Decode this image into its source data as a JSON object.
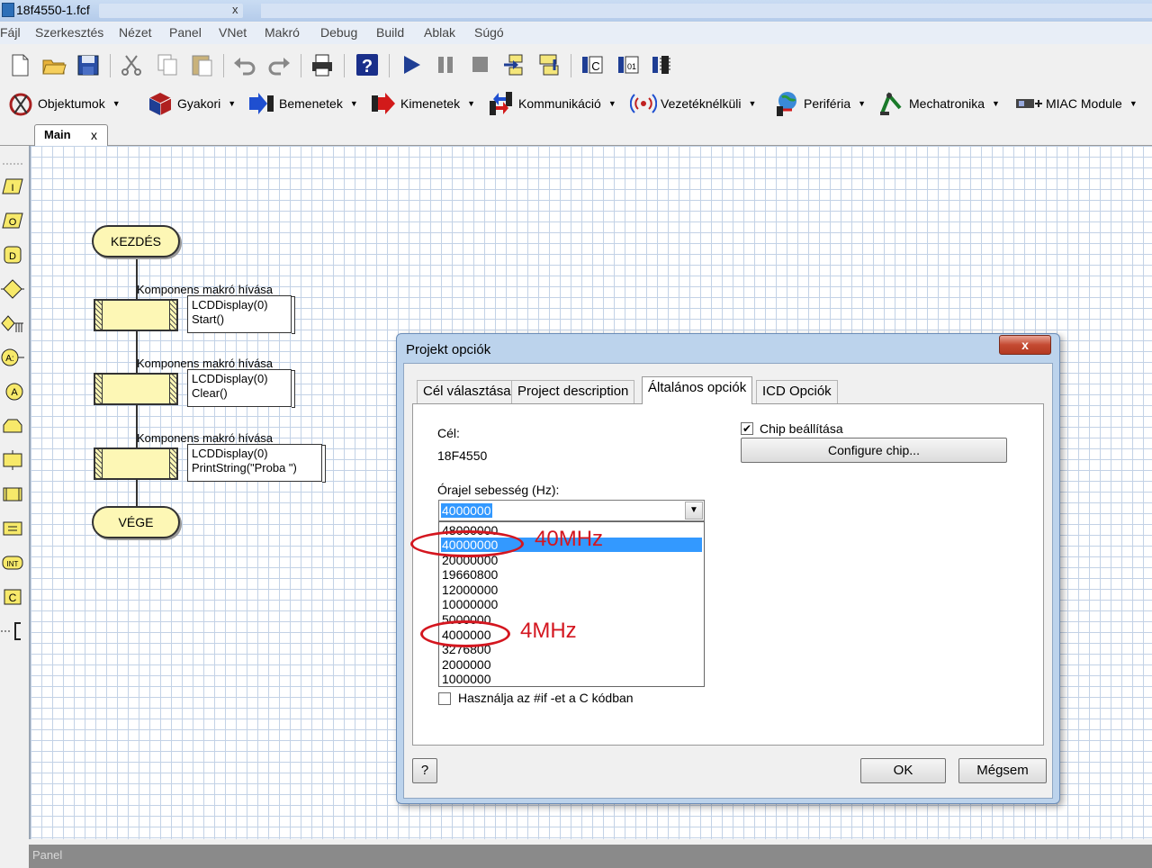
{
  "window": {
    "title": "18f4550-1.fcf",
    "close_glyph": "x"
  },
  "menu": [
    "Fájl",
    "Szerkesztés",
    "Nézet",
    "Panel",
    "VNet",
    "Makró",
    "Debug",
    "Build",
    "Ablak",
    "Súgó"
  ],
  "toolbar_components": [
    {
      "label": "Objektumok"
    },
    {
      "label": "Gyakori"
    },
    {
      "label": "Bemenetek"
    },
    {
      "label": "Kimenetek"
    },
    {
      "label": "Kommunikáció"
    },
    {
      "label": "Vezetéknélküli"
    },
    {
      "label": "Periféria"
    },
    {
      "label": "Mechatronika"
    },
    {
      "label": "MIAC Module"
    }
  ],
  "tab": {
    "label": "Main",
    "close": "x"
  },
  "flowchart": {
    "start": "KEZDÉS",
    "end": "VÉGE",
    "macros": [
      {
        "heading": "Komponens makró hívása",
        "line1": "LCDDisplay(0)",
        "line2": "Start()"
      },
      {
        "heading": "Komponens makró hívása",
        "line1": "LCDDisplay(0)",
        "line2": "Clear()"
      },
      {
        "heading": "Komponens makró hívása",
        "line1": "LCDDisplay(0)",
        "line2": "PrintString(\"Proba \")"
      }
    ]
  },
  "dialog": {
    "title": "Projekt opciók",
    "close": "x",
    "tabs": [
      "Cél választása",
      "Project description",
      "Általános opciók",
      "ICD Opciók"
    ],
    "active_tab": 2,
    "target_label": "Cél:",
    "target_value": "18F4550",
    "clock_label": "Órajel sebesség (Hz):",
    "clock_value": "4000000",
    "clock_options": [
      "48000000",
      "40000000",
      "20000000",
      "19660800",
      "12000000",
      "10000000",
      "5000000",
      "4000000",
      "3276800",
      "2000000",
      "1000000"
    ],
    "highlighted_option": "40000000",
    "chip_setting_label": "Chip beállítása",
    "chip_setting_checked": true,
    "configure_chip_button": "Configure chip...",
    "ifdef_label": "Használja az #if -et a C kódban",
    "ifdef_checked": false,
    "help_button": "?",
    "ok_button": "OK",
    "cancel_button": "Mégsem"
  },
  "annotations": {
    "mhz40": "40MHz",
    "mhz4": "4MHz"
  },
  "statusbar": {
    "label": "Panel"
  },
  "colors": {
    "highlight": "#3399ff",
    "annotation": "#d4161f",
    "flow_fill": "#fdf7b5",
    "grid": "#c3d2e6"
  }
}
